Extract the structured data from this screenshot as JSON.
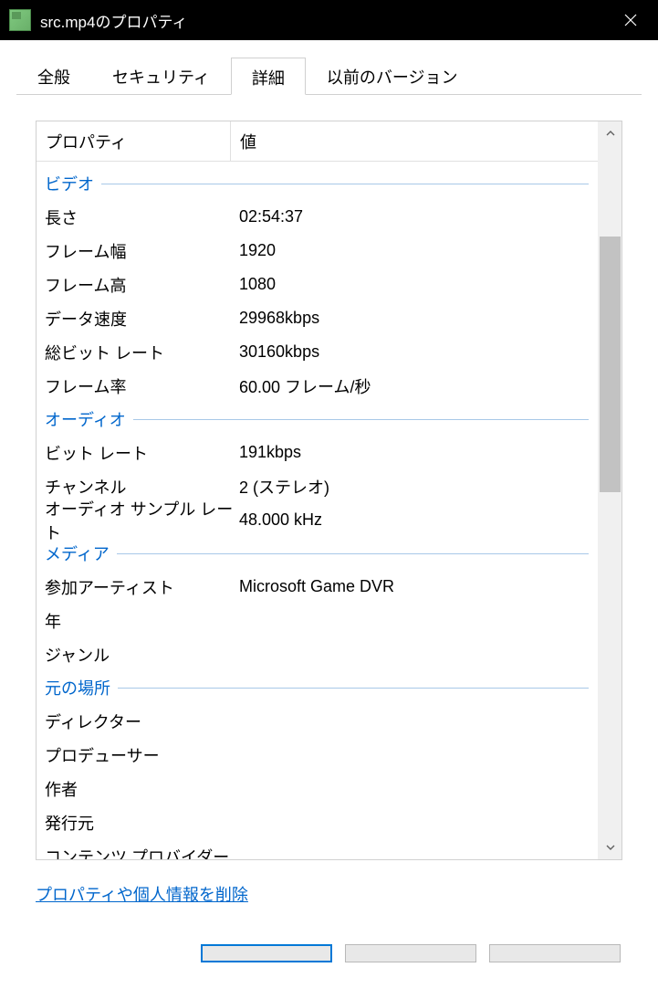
{
  "window": {
    "title": "src.mp4のプロパティ"
  },
  "tabs": {
    "general": "全般",
    "security": "セキュリティ",
    "details": "詳細",
    "previous": "以前のバージョン"
  },
  "headers": {
    "property": "プロパティ",
    "value": "値"
  },
  "groups": {
    "video": "ビデオ",
    "audio": "オーディオ",
    "media": "メディア",
    "origin": "元の場所"
  },
  "video": {
    "length_label": "長さ",
    "length_value": "02:54:37",
    "frame_width_label": "フレーム幅",
    "frame_width_value": "1920",
    "frame_height_label": "フレーム高",
    "frame_height_value": "1080",
    "data_rate_label": "データ速度",
    "data_rate_value": "29968kbps",
    "total_bitrate_label": "総ビット レート",
    "total_bitrate_value": "30160kbps",
    "frame_rate_label": "フレーム率",
    "frame_rate_value": "60.00 フレーム/秒"
  },
  "audio": {
    "bitrate_label": "ビット レート",
    "bitrate_value": "191kbps",
    "channels_label": "チャンネル",
    "channels_value": "2 (ステレオ)",
    "sample_rate_label": "オーディオ サンプル レート",
    "sample_rate_value": "48.000 kHz"
  },
  "media": {
    "artist_label": "参加アーティスト",
    "artist_value": "Microsoft Game DVR",
    "year_label": "年",
    "year_value": "",
    "genre_label": "ジャンル",
    "genre_value": ""
  },
  "origin": {
    "director_label": "ディレクター",
    "director_value": "",
    "producer_label": "プロデューサー",
    "producer_value": "",
    "author_label": "作者",
    "author_value": "",
    "publisher_label": "発行元",
    "publisher_value": "",
    "content_provider_label": "コンテンツ プロバイダー",
    "content_provider_value": ""
  },
  "links": {
    "remove_properties": "プロパティや個人情報を削除"
  }
}
